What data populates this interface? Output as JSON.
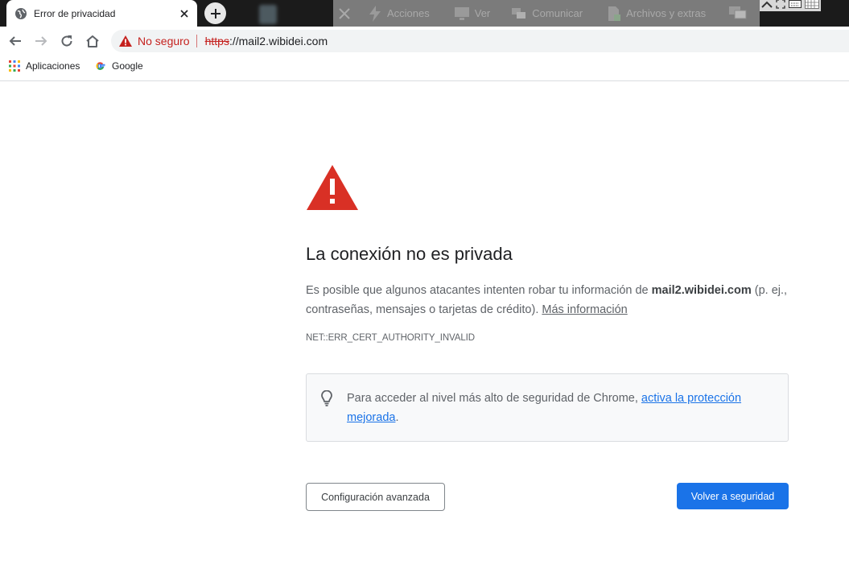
{
  "tab": {
    "title": "Error de privacidad"
  },
  "remote_toolbar": {
    "items": [
      {
        "label": "Acciones",
        "icon": "lightning-icon"
      },
      {
        "label": "Ver",
        "icon": "monitor-icon"
      },
      {
        "label": "Comunicar",
        "icon": "chat-icon"
      },
      {
        "label": "Archivos y extras",
        "icon": "file-icon"
      }
    ]
  },
  "omnibox": {
    "security_label": "No seguro",
    "url_scheme": "https",
    "url_rest": "://mail2.wibidei.com"
  },
  "bookmarks": [
    {
      "label": "Aplicaciones",
      "icon": "apps-grid-icon"
    },
    {
      "label": "Google",
      "icon": "google-icon"
    }
  ],
  "error": {
    "heading": "La conexión no es privada",
    "desc_before": "Es posible que algunos atacantes intenten robar tu información de ",
    "domain": "mail2.wibidei.com",
    "desc_after": " (p. ej., contraseñas, mensajes o tarjetas de crédito). ",
    "more_info": "Más información",
    "code": "NET::ERR_CERT_AUTHORITY_INVALID"
  },
  "tip": {
    "text_before": "Para acceder al nivel más alto de seguridad de Chrome, ",
    "link": "activa la protección mejorada",
    "text_after": "."
  },
  "buttons": {
    "advanced": "Configuración avanzada",
    "back": "Volver a seguridad"
  },
  "colors": {
    "danger": "#d93025",
    "primary": "#1a73e8"
  }
}
